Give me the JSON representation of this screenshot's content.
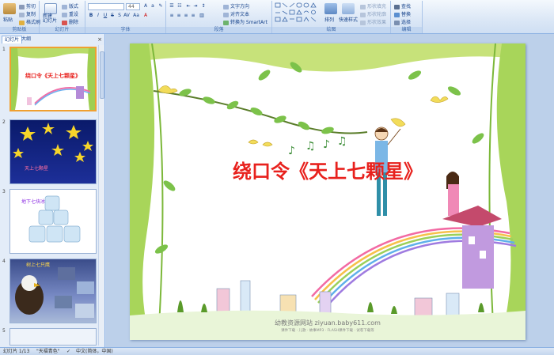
{
  "ribbon": {
    "clipboard": {
      "label": "剪贴板",
      "paste": "粘贴",
      "cut": "剪切",
      "copy": "复制",
      "format_painter": "格式刷"
    },
    "slides": {
      "label": "幻灯片",
      "new_slide": "新建\n幻灯片",
      "layout": "版式",
      "reset": "重设",
      "delete": "删除"
    },
    "font": {
      "label": "字体",
      "font_name": "",
      "font_size": "44"
    },
    "paragraph": {
      "label": "段落",
      "text_direction": "文字方向",
      "align_text": "对齐文本",
      "smartart": "转换为 SmartArt"
    },
    "drawing": {
      "label": "绘图",
      "arrange": "排列",
      "quick_styles": "快速样式",
      "shape_fill": "形状填充",
      "shape_outline": "形状轮廓",
      "shape_effects": "形状效果"
    },
    "editing": {
      "label": "编辑",
      "find": "查找",
      "replace": "替换",
      "select": "选择"
    }
  },
  "panel": {
    "tab_slides": "幻灯片",
    "tab_outline": "大纲",
    "close": "×"
  },
  "thumbnails": [
    {
      "num": "1",
      "title": "绕口令《天上七颗星》"
    },
    {
      "num": "2",
      "title": "天上七颗星"
    },
    {
      "num": "3",
      "title": "地下七块冰"
    },
    {
      "num": "4",
      "title": "树上七只鹰"
    },
    {
      "num": "5"
    }
  ],
  "slide": {
    "title": "绕口令《天上七颗星》",
    "watermark": "幼教资源网站 ziyuan.baby611.com",
    "watermark_sub": "课件下载 · 儿歌 · 故事MP3 · FLASH课件下载 · 试卷下载等"
  },
  "status": {
    "slide_index": "幻灯片 1/13",
    "theme": "\"天福青色\"",
    "language": "中文(简体，中国)"
  },
  "colors": {
    "title_red": "#e8211d",
    "ribbon_blue": "#dbe7f6",
    "selected_thumb": "#f0a030"
  }
}
